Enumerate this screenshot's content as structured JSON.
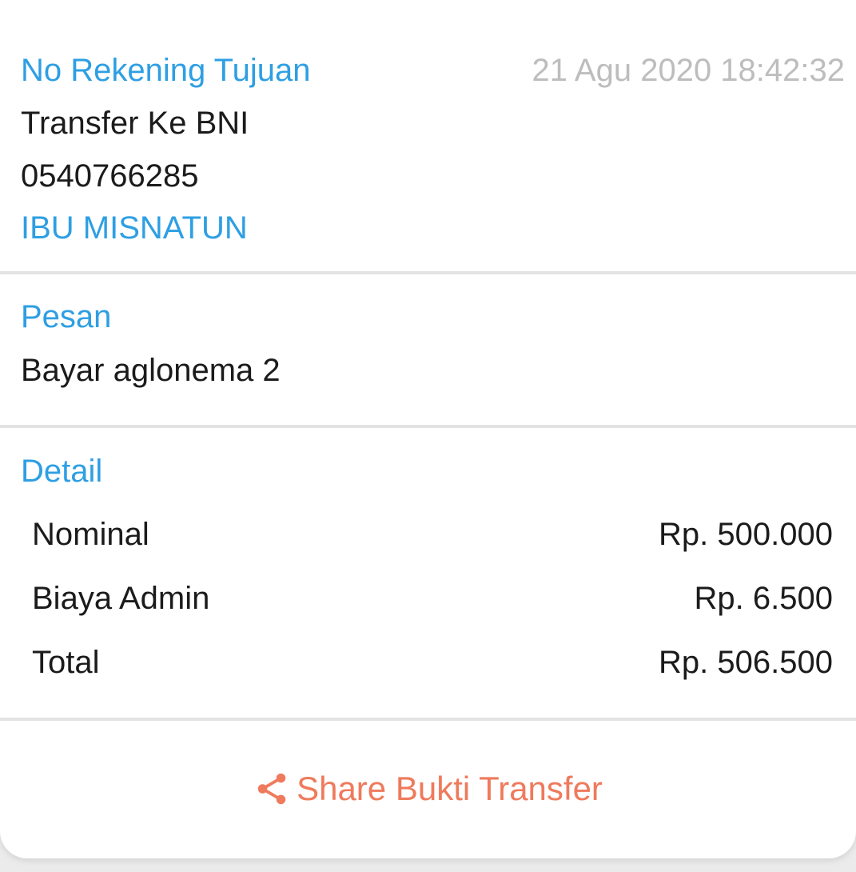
{
  "recipient_section": {
    "title": "No Rekening Tujuan",
    "timestamp": "21 Agu 2020 18:42:32",
    "bank_line": "Transfer Ke BNI",
    "account_number": "0540766285",
    "account_name": "IBU MISNATUN"
  },
  "message_section": {
    "title": "Pesan",
    "text": "Bayar aglonema 2"
  },
  "detail_section": {
    "title": "Detail",
    "rows": [
      {
        "label": "Nominal",
        "value": "Rp. 500.000"
      },
      {
        "label": "Biaya Admin",
        "value": "Rp. 6.500"
      },
      {
        "label": "Total",
        "value": "Rp. 506.500"
      }
    ]
  },
  "share": {
    "label": "Share Bukti Transfer",
    "icon": "share-icon"
  },
  "colors": {
    "accent_blue": "#2e9fe3",
    "share_orange": "#ef7a5c",
    "timestamp_gray": "#bdbdbd",
    "text_black": "#1b1b1b",
    "divider": "#e3e3e3"
  }
}
